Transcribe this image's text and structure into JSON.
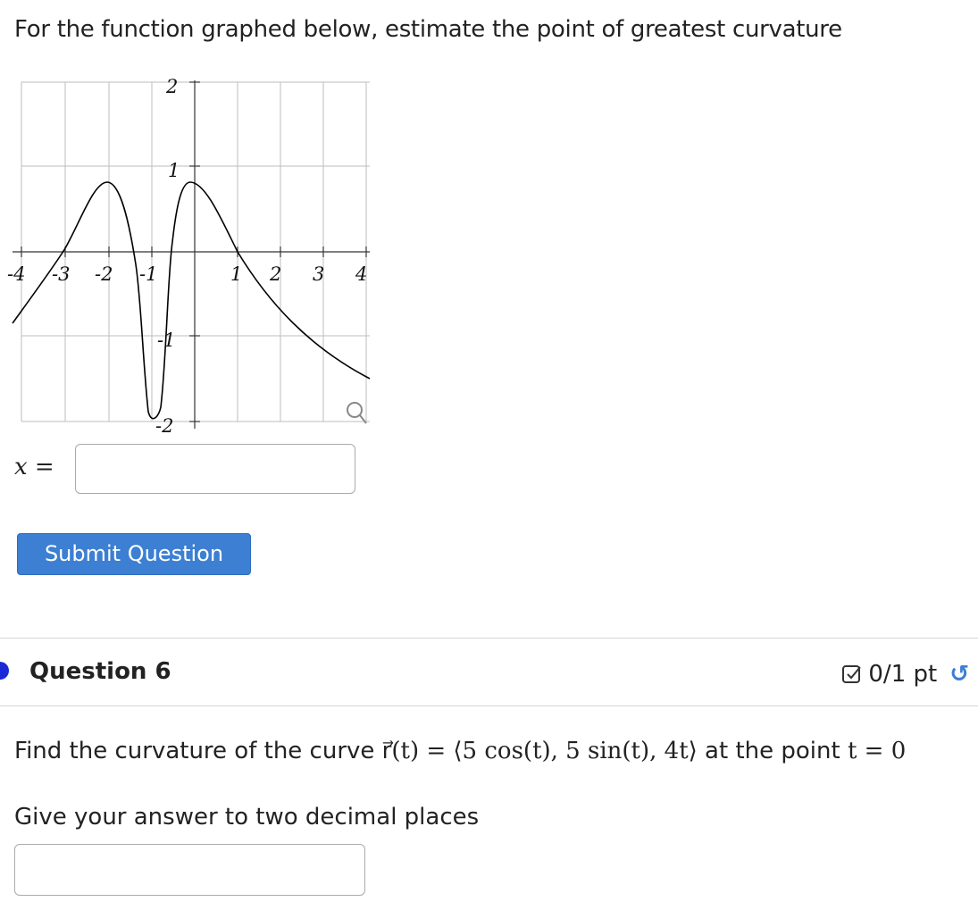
{
  "question5": {
    "prompt": "For the function graphed below, estimate the point of greatest curvature",
    "graph": {
      "x_tick_labels": [
        "-4",
        "-3",
        "-2",
        "-1",
        "1",
        "2",
        "3",
        "4"
      ],
      "y_tick_labels": [
        "2",
        "1",
        "-1",
        "-2"
      ],
      "zoom_icon": "magnifier-icon"
    },
    "answer_label": "x =",
    "answer_value": "",
    "submit_label": "Submit Question"
  },
  "question6": {
    "title": "Question 6",
    "score": "0/1 pt",
    "score_icon": "checkbox-icon",
    "text_before": "Find the curvature of the curve ",
    "math": "r⃗(t) = ⟨5 cos(t), 5 sin(t), 4t⟩",
    "text_after": " at the point ",
    "point": "t = 0",
    "hint": "Give your answer to two decimal places",
    "answer_value": ""
  },
  "colors": {
    "accent": "#3c7fd3",
    "question_dot": "#1a2ad6",
    "divider": "#d6d6d6"
  }
}
